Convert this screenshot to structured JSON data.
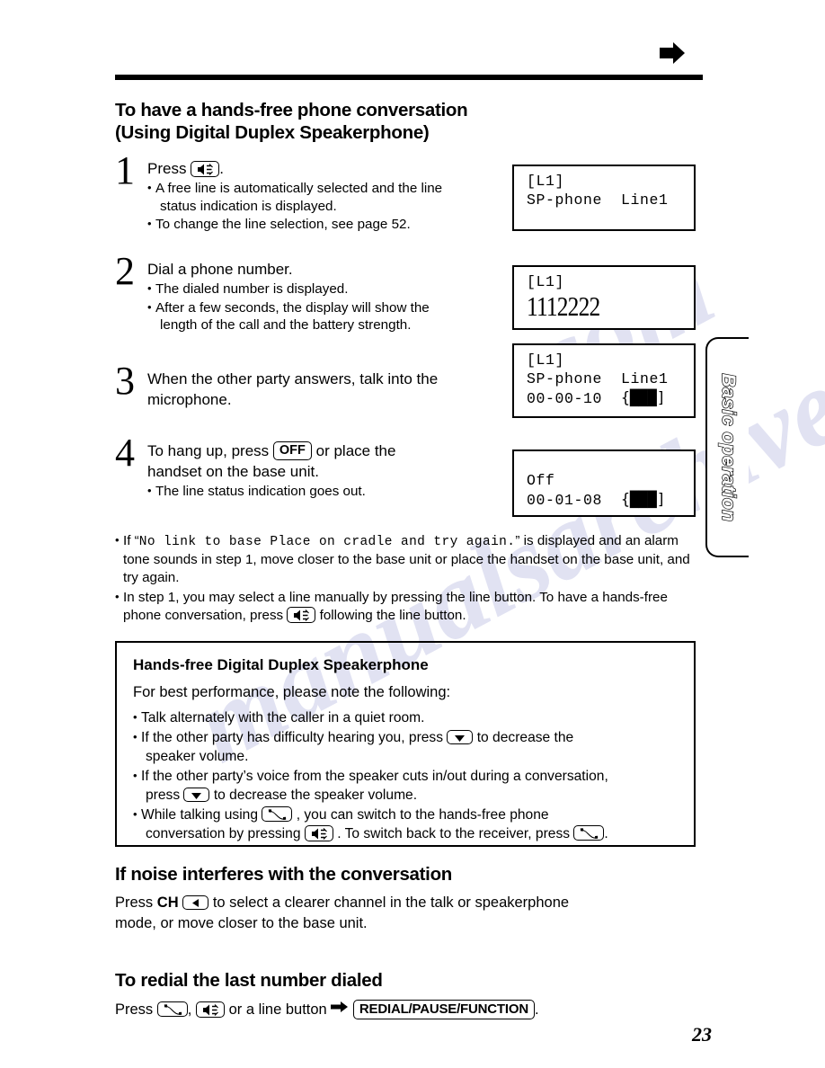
{
  "header": {
    "arrow_icon": "right-arrow-icon"
  },
  "title": {
    "line1": "To have a hands-free phone conversation",
    "line2": "(Using Digital Duplex Speakerphone)"
  },
  "steps": [
    {
      "number": "1",
      "lead_prefix": "Press",
      "lead_key_icon": "speakerphone-icon",
      "lead_suffix": ".",
      "bullets": [
        "A free line is automatically selected and the line",
        "status indication is displayed.",
        "To change the line selection, see page 52."
      ],
      "bullet_items": [
        {
          "text": "A free line is automatically selected and the line",
          "cont": "status indication is displayed."
        },
        {
          "text": "To change the line selection, see page 52.",
          "cont": ""
        }
      ]
    },
    {
      "number": "2",
      "lead_prefix": "Dial a phone number.",
      "bullet_items": [
        {
          "text": "The dialed number is displayed.",
          "cont": ""
        },
        {
          "text": "After a few seconds, the display will show the",
          "cont": "length of the call and the battery strength."
        }
      ]
    },
    {
      "number": "3",
      "lead_prefix": "When the other party answers, talk into the",
      "lead_line2": "microphone.",
      "bullet_items": []
    },
    {
      "number": "4",
      "lead_prefix": "To hang up, press",
      "lead_key_label": "OFF",
      "lead_after_key": "or place the",
      "lead_line2": "handset on the base unit.",
      "bullet_items": [
        {
          "text": "The line status indication goes out.",
          "cont": ""
        }
      ]
    }
  ],
  "lcd_displays": [
    {
      "id": "lcd-step1",
      "line1": "[L1]",
      "line2": "SP-phone  Line1"
    },
    {
      "id": "lcd-step2",
      "line1": "[L1]",
      "big_number": "1112222"
    },
    {
      "id": "lcd-step3",
      "line1": "[L1]",
      "line2": "SP-phone  Line1",
      "line3_time": "00-00-10",
      "line3_battery": "{███]"
    },
    {
      "id": "lcd-step4",
      "line1": "Off",
      "line2_time": "00-01-08",
      "line2_battery": "{███]"
    }
  ],
  "notes": [
    {
      "pre": "If “",
      "mono": "No link to base Place on cradle and try again.",
      "post": "” is displayed",
      "line2": "and an alarm tone sounds in step 1, move closer to the base unit or place the",
      "line3": "handset on the base unit, and try again."
    },
    {
      "line1": "In step 1, you may select a line manually by pressing the line button. To have a",
      "line2_pre": "hands-free phone conversation, press",
      "line2_key": "speakerphone-icon",
      "line2_post": "following the line button."
    }
  ],
  "callout": {
    "title": "Hands-free Digital Duplex Speakerphone",
    "subtitle": "For best performance, please note the following:",
    "items": [
      {
        "text": "Talk alternately with the caller in a quiet room."
      },
      {
        "pre": "If the other party has difficulty hearing you, press",
        "key": "down-arrow-icon",
        "post": "to decrease the",
        "cont": "speaker volume."
      },
      {
        "pre": "If the other party’s voice from the speaker cuts in/out during a conversation,",
        "cont_pre": "press",
        "key": "down-arrow-icon",
        "cont_post": "to decrease the speaker volume."
      },
      {
        "pre": "While talking using",
        "key": "handset-talk-icon",
        "post": ", you can switch to the hands-free phone",
        "cont_pre": "conversation by pressing",
        "cont_key": "speakerphone-icon",
        "cont_mid": ". To switch back to the receiver, press",
        "cont_key2": "handset-talk-icon",
        "cont_post": "."
      }
    ]
  },
  "noise_section": {
    "heading": "If noise interferes with the conversation",
    "para_pre": "Press",
    "para_bold": "CH",
    "para_key": "left-arrow-icon",
    "para_post": "to select a clearer channel in the talk or speakerphone",
    "para_line2": "mode, or move closer to the base unit."
  },
  "redial_section": {
    "heading": "To redial the last number dialed",
    "para_pre": "Press",
    "key1": "handset-talk-icon",
    "sep1": ",",
    "key2": "speakerphone-icon",
    "mid": "or a line button",
    "arrow": "right-arrow-icon",
    "key3_label": "REDIAL/PAUSE/FUNCTION",
    "end": "."
  },
  "side_tab": {
    "label": "Basic operation"
  },
  "page_number": "23",
  "watermark": {
    "text1": "manualsarchive",
    "text2": ".com"
  }
}
